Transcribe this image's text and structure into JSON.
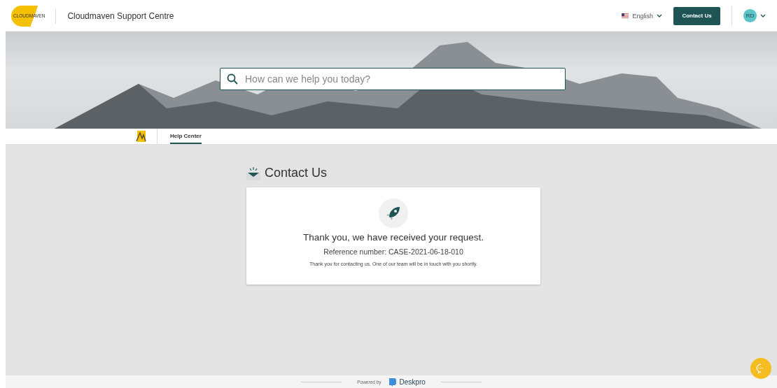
{
  "header": {
    "logo_text": "CLOUDMAVEN",
    "title": "Cloudmaven Support Centre",
    "language": "English",
    "contact_button": "Contact Us",
    "avatar_initials": "RD"
  },
  "search": {
    "placeholder": "How can we help you today?"
  },
  "tabs": [
    {
      "label": "Help Center",
      "selected": true
    }
  ],
  "page_title": "Contact Us",
  "confirmation": {
    "heading": "Thank you, we have received your request.",
    "reference": "Reference number: CASE-2021-06-18-010",
    "message": "Thank you for contacting us. One of our team will be in touch with you shortly."
  },
  "footer": {
    "powered_by": "Powered by",
    "brand": "Deskpro"
  }
}
